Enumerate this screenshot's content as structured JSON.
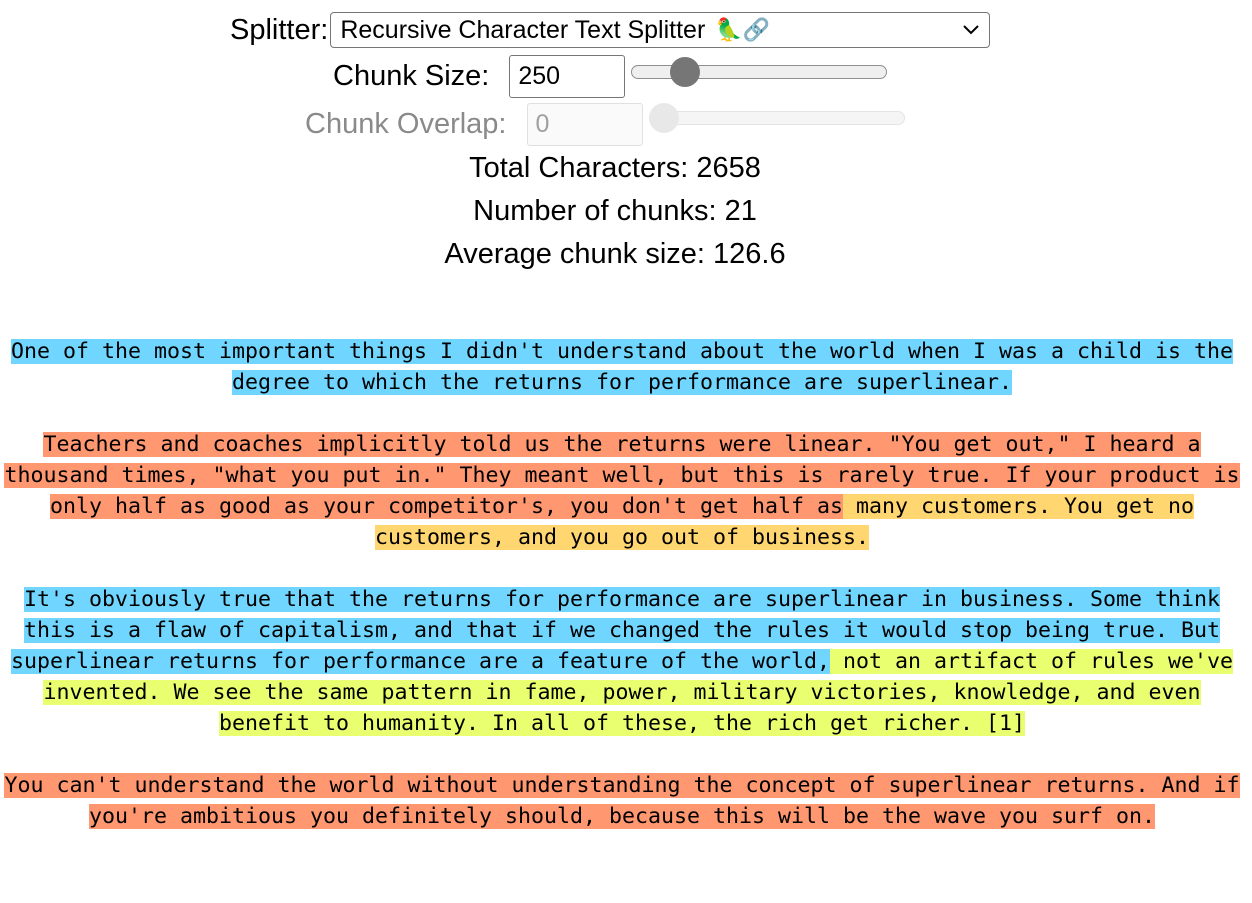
{
  "controls": {
    "splitter_label": "Splitter:",
    "splitter_value": "Recursive Character Text Splitter",
    "splitter_emoji": "🦜🔗",
    "chunk_size_label": "Chunk Size:",
    "chunk_size_value": "250",
    "chunk_size_slider_fraction": 0.17,
    "chunk_overlap_label": "Chunk Overlap:",
    "chunk_overlap_value": "0",
    "chunk_overlap_slider_fraction": 0.0
  },
  "stats": {
    "total": "Total Characters: 2658",
    "chunks": "Number of chunks: 21",
    "average": "Average chunk size: 126.6"
  },
  "colors": {
    "blue": "#70d6ff",
    "orange": "#ff9770",
    "yellow": "#ffd670",
    "lime": "#e9ff70"
  },
  "paragraphs": [
    [
      {
        "color": "blue",
        "text": "One of the most important things I didn't understand about the world when I was a child is the degree to which the returns for performance are superlinear."
      }
    ],
    [
      {
        "color": "orange",
        "text": "Teachers and coaches implicitly told us the returns were linear. \"You get out,\" I heard a thousand times, \"what you put in.\" They meant well, but this is rarely true. If your product is only half as good as your competitor's, you don't get half as"
      },
      {
        "color": "yellow",
        "text": " many customers. You get no customers, and you go out of business."
      }
    ],
    [
      {
        "color": "blue",
        "text": "It's obviously true that the returns for performance are superlinear in business. Some think this is a flaw of capitalism, and that if we changed the rules it would stop being true. But superlinear returns for performance are a feature of the world,"
      },
      {
        "color": "lime",
        "text": " not an artifact of rules we've invented. We see the same pattern in fame, power, military victories, knowledge, and even benefit to humanity. In all of these, the rich get richer. [1]"
      }
    ],
    [
      {
        "color": "orange",
        "text": "You can't understand the world without understanding the concept of superlinear returns. And if you're ambitious you definitely should, because this will be the wave you surf on."
      }
    ]
  ]
}
